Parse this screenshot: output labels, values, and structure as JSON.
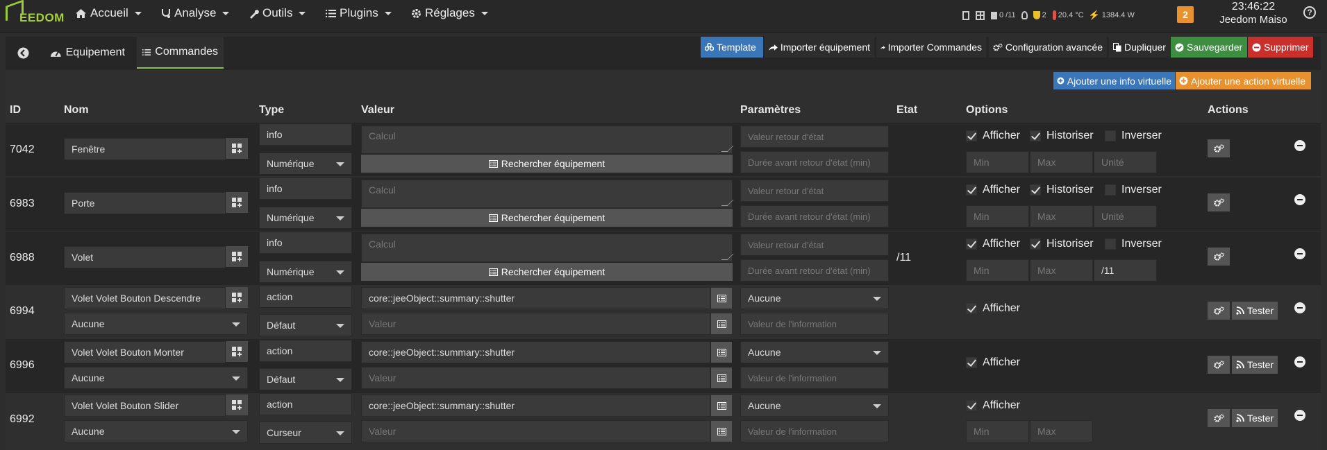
{
  "navbar": {
    "logo": "EEDOM",
    "menu": [
      "Accueil",
      "Analyse",
      "Outils",
      "Plugins",
      "Réglages"
    ],
    "status": {
      "summary1": "0 /11",
      "summary2": "2",
      "temp": "20.4 °C",
      "power": "1384.4 W"
    },
    "notif_count": "2",
    "time": "23:46:22",
    "name": "Jeedom Maiso"
  },
  "tabs": [
    "Equipement",
    "Commandes"
  ],
  "toolbar": [
    {
      "label": "Template",
      "color": "#3a76b8",
      "icon": "template-icon"
    },
    {
      "label": "Importer équipement",
      "color": "#2d2d2d",
      "icon": "share-icon"
    },
    {
      "label": "Importer Commandes",
      "color": "#2d2d2d",
      "icon": "share-icon"
    },
    {
      "label": "Configuration avancée",
      "color": "#2d2d2d",
      "icon": "cogs-icon"
    },
    {
      "label": "Dupliquer",
      "color": "#2d2d2d",
      "icon": "copy-icon"
    },
    {
      "label": "Sauvegarder",
      "color": "#3e8e41",
      "icon": "check-circle-icon"
    },
    {
      "label": "Supprimer",
      "color": "#c9302c",
      "icon": "minus-circle-icon"
    }
  ],
  "add_buttons": {
    "info": "Ajouter une info virtuelle",
    "action": "Ajouter une action virtuelle"
  },
  "headers": {
    "id": "ID",
    "nom": "Nom",
    "type": "Type",
    "valeur": "Valeur",
    "parametres": "Paramètres",
    "etat": "Etat",
    "options": "Options",
    "actions": "Actions"
  },
  "placeholders": {
    "calcul": "Calcul",
    "retour": "Valeur retour d'état",
    "duree": "Durée avant retour d'état (min)",
    "min": "Min",
    "max": "Max",
    "unite": "Unité",
    "valeur": "Valeur",
    "valeur_info": "Valeur de l'information"
  },
  "labels": {
    "rechercher": "Rechercher équipement",
    "afficher": "Afficher",
    "historiser": "Historiser",
    "inverser": "Inverser",
    "tester": "Tester"
  },
  "info_rows": [
    {
      "id": "7042",
      "nom": "Fenêtre",
      "type": "info",
      "subtype": "Numérique",
      "etat": "",
      "unite": ""
    },
    {
      "id": "6983",
      "nom": "Porte",
      "type": "info",
      "subtype": "Numérique",
      "etat": "",
      "unite": ""
    },
    {
      "id": "6988",
      "nom": "Volet",
      "type": "info",
      "subtype": "Numérique",
      "etat": "/11",
      "unite": "/11"
    }
  ],
  "action_rows": [
    {
      "id": "6994",
      "nom": "Volet Volet Bouton Descendre",
      "info": "Aucune",
      "type": "action",
      "subtype": "Défaut",
      "valeur": "core::jeeObject::summary::shutter",
      "param": "Aucune"
    },
    {
      "id": "6996",
      "nom": "Volet Volet Bouton Monter",
      "info": "Aucune",
      "type": "action",
      "subtype": "Défaut",
      "valeur": "core::jeeObject::summary::shutter",
      "param": "Aucune"
    },
    {
      "id": "6992",
      "nom": "Volet Volet Bouton Slider",
      "info": "Aucune",
      "type": "action",
      "subtype": "Curseur",
      "valeur": "core::jeeObject::summary::shutter",
      "param": "Aucune"
    }
  ]
}
